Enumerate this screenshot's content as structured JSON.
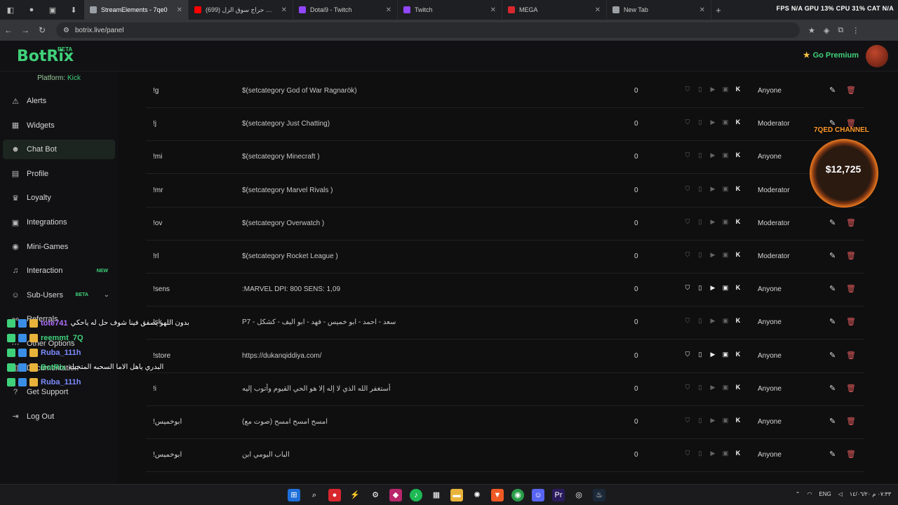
{
  "browser": {
    "tabs": [
      {
        "title": "StreamElements - 7qe0",
        "color": "#9aa0a6",
        "active": true
      },
      {
        "title": "تحديات حراج سوق الزل (699)",
        "color": "#ff0000",
        "active": false
      },
      {
        "title": "Dotai9 - Twitch",
        "color": "#9146ff",
        "active": false
      },
      {
        "title": "Twitch",
        "color": "#9146ff",
        "active": false
      },
      {
        "title": "MEGA",
        "color": "#d9272e",
        "active": false
      },
      {
        "title": "New Tab",
        "color": "#9aa0a6",
        "active": false
      }
    ],
    "url": "botrix.live/panel",
    "stats": "FPS N/A  GPU 13%  CPU 31%  CAT N/A"
  },
  "header": {
    "logo": "BotRix",
    "beta": "BETA",
    "premium": "Go Premium"
  },
  "sidebar": {
    "platform_label": "Platform:",
    "platform_value": "Kick",
    "items": [
      {
        "label": "Alerts",
        "icon": "warning-icon"
      },
      {
        "label": "Widgets",
        "icon": "grid-icon"
      },
      {
        "label": "Chat Bot",
        "icon": "robot-icon"
      },
      {
        "label": "Profile",
        "icon": "profile-icon"
      },
      {
        "label": "Loyalty",
        "icon": "trophy-icon"
      },
      {
        "label": "Integrations",
        "icon": "integrations-icon"
      },
      {
        "label": "Mini-Games",
        "icon": "gamepad-icon"
      },
      {
        "label": "Interaction",
        "icon": "music-icon",
        "tag": "NEW"
      },
      {
        "label": "Sub-Users",
        "icon": "users-icon",
        "tag": "BETA"
      },
      {
        "label": "Referrals",
        "icon": "link-icon"
      },
      {
        "label": "Other Options",
        "icon": "options-icon"
      },
      {
        "label": "Documentation",
        "icon": "doc-icon"
      },
      {
        "label": "Get Support",
        "icon": "help-icon"
      },
      {
        "label": "Log Out",
        "icon": "logout-icon"
      }
    ]
  },
  "commands": [
    {
      "cmd": "!g",
      "response": "$(setcategory God of War Ragnarök)",
      "count": "0",
      "permission": "Anyone",
      "platforms_on": false
    },
    {
      "cmd": "!j",
      "response": "$(setcategory Just Chatting)",
      "count": "0",
      "permission": "Moderator",
      "platforms_on": false
    },
    {
      "cmd": "!mi",
      "response": "$(setcategory Minecraft )",
      "count": "0",
      "permission": "Anyone",
      "platforms_on": false
    },
    {
      "cmd": "!mr",
      "response": "$(setcategory Marvel Rivals )",
      "count": "0",
      "permission": "Moderator",
      "platforms_on": false
    },
    {
      "cmd": "!ov",
      "response": "$(setcategory Overwatch )",
      "count": "0",
      "permission": "Moderator",
      "platforms_on": false
    },
    {
      "cmd": "!rl",
      "response": "$(setcategory Rocket League )",
      "count": "0",
      "permission": "Moderator",
      "platforms_on": false
    },
    {
      "cmd": "!sens",
      "response": ":MARVEL DPI: 800 SENS: 1,09",
      "count": "0",
      "permission": "Anyone",
      "platforms_on": true
    },
    {
      "cmd": "!sk",
      "response": "P7 - سعد - احمد - ابو خميس - فهد - ابو اليف - كشكل",
      "count": "0",
      "permission": "Anyone",
      "platforms_on": false
    },
    {
      "cmd": "!store",
      "response": "https://dukanqiddiya.com/",
      "count": "0",
      "permission": "Anyone",
      "platforms_on": true
    },
    {
      "cmd": "!i",
      "response": "أستغفر الله الذي لا إله إلا هو الحي القيوم وأتوب إليه",
      "count": "0",
      "permission": "Anyone",
      "platforms_on": false
    },
    {
      "cmd": "!ابوخميس",
      "response": "امسح امسح امسح (صوت مع)",
      "count": "0",
      "permission": "Anyone",
      "platforms_on": false
    },
    {
      "cmd": "!ابوخميس",
      "response": "الباب اليومي ابن",
      "count": "0",
      "permission": "Anyone",
      "platforms_on": false
    }
  ],
  "donation": {
    "title": "7QED CHANNEL",
    "amount": "$12,725"
  },
  "chat": [
    {
      "user": "tote741",
      "color": "#b070ff",
      "msg": "بدون اللهو يصفق فينا شوف حل له ياحكي"
    },
    {
      "user": "reemmt_7Q",
      "color": "#3fd17a",
      "msg": ""
    },
    {
      "user": "Ruba_111h",
      "color": "#7c8cff",
      "msg": ""
    },
    {
      "user": "BotRix",
      "color": "#3fd17a",
      "msg": "البدري ياهل الاما السحبه المتخيلة"
    },
    {
      "user": "Ruba_111h",
      "color": "#7c8cff",
      "msg": ""
    }
  ],
  "tray": {
    "lang": "ENG",
    "time": "٠٧:٣٣ م",
    "date": "١٤/٠٦/٢٠"
  }
}
